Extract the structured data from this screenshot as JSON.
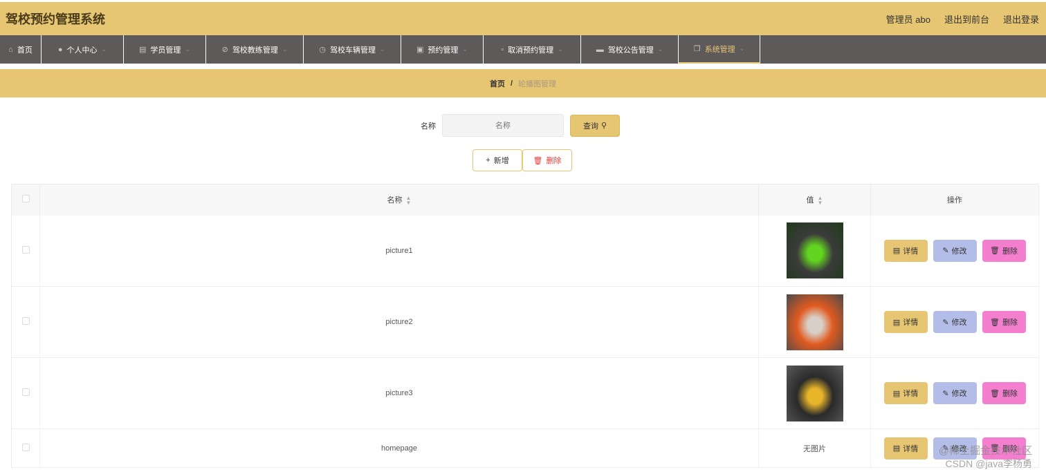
{
  "header": {
    "title": "驾校预约管理系统",
    "admin_label": "管理员 abo",
    "to_front_label": "退出到前台",
    "logout_label": "退出登录"
  },
  "nav": {
    "items": [
      {
        "label": "首页",
        "icon": "home-icon"
      },
      {
        "label": "个人中心",
        "icon": "user-icon"
      },
      {
        "label": "学员管理",
        "icon": "chart-icon"
      },
      {
        "label": "驾校教练管理",
        "icon": "bell-off-icon"
      },
      {
        "label": "驾校车辆管理",
        "icon": "compass-icon"
      },
      {
        "label": "预约管理",
        "icon": "suitcase-icon"
      },
      {
        "label": "取消预约管理",
        "icon": "clipboard-icon"
      },
      {
        "label": "驾校公告管理",
        "icon": "monitor-icon"
      },
      {
        "label": "系统管理",
        "icon": "copy-icon"
      }
    ],
    "active_index": 8
  },
  "breadcrumb": {
    "home": "首页",
    "separator": "/",
    "current": "轮播图管理"
  },
  "search": {
    "label": "名称",
    "placeholder": "名称",
    "query_label": "查询"
  },
  "toolbar": {
    "add_label": "新增",
    "delete_label": "删除"
  },
  "table": {
    "columns": [
      "名称",
      "值",
      "操作"
    ],
    "rows": [
      {
        "name": "picture1",
        "value": "image",
        "image_colors": [
          "#1f3b1a",
          "#63d420",
          "#3b3b3b"
        ]
      },
      {
        "name": "picture2",
        "value": "image",
        "image_colors": [
          "#4a4a4a",
          "#d8d0c8",
          "#e05a1f"
        ]
      },
      {
        "name": "picture3",
        "value": "image",
        "image_colors": [
          "#5a5a5a",
          "#e7b52a",
          "#2a2a2a"
        ]
      },
      {
        "name": "homepage",
        "value": "无图片",
        "image_colors": []
      }
    ],
    "ops": {
      "detail": "详情",
      "edit": "修改",
      "delete": "删除"
    }
  },
  "watermark": {
    "line1": "@稀土掘金技术社区",
    "line2": "CSDN @java李杨勇"
  },
  "colors": {
    "accent": "#e6c573",
    "nav_bg": "#5e5a5a",
    "edit_btn": "#b3bde8",
    "delete_btn": "#f47fcf"
  }
}
